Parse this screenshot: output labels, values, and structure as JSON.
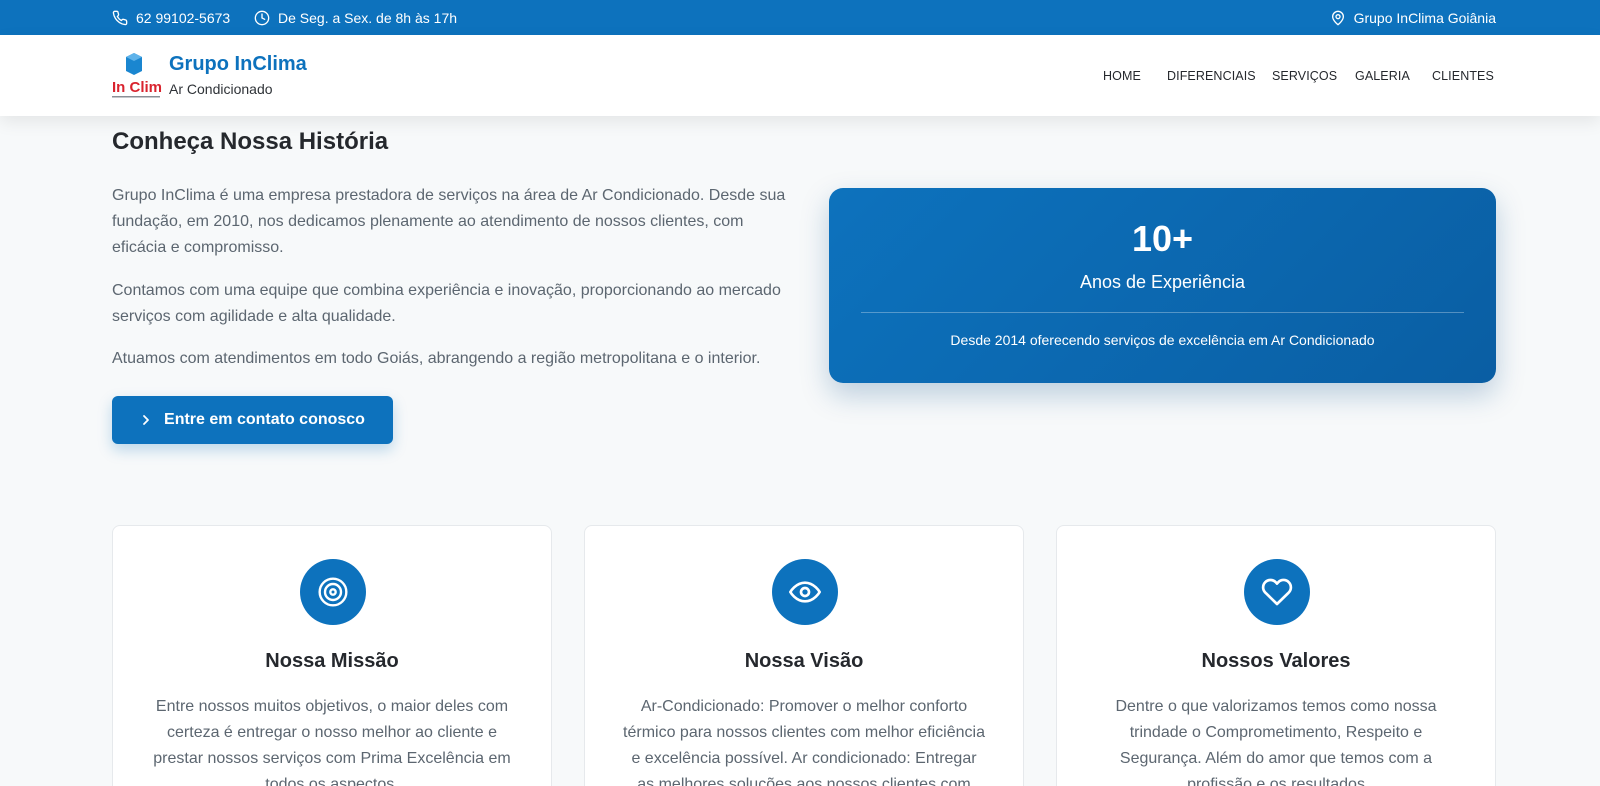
{
  "colors": {
    "primary": "#0d72bd",
    "background": "#f7f9fa",
    "text_muted": "#5c6670"
  },
  "topbar": {
    "phone": "62 99102-5673",
    "phone_icon": "phone-icon",
    "hours": "De Seg. a Sex. de 8h às 17h",
    "hours_icon": "clock-icon",
    "location": "Grupo InClima Goiânia",
    "location_icon": "map-pin-icon"
  },
  "header": {
    "brand_title": "Grupo InClima",
    "brand_subtitle": "Ar Condicionado",
    "logo_text": "In Clima",
    "nav": [
      "HOME",
      "DIFERENCIAIS",
      "SERVIÇOS",
      "GALERIA",
      "CLIENTES"
    ]
  },
  "history": {
    "title": "Conheça Nossa História",
    "paragraphs": [
      "Grupo InClima é uma empresa prestadora de serviços na área de Ar Condicionado. Desde sua fundação, em 2010, nos dedicamos plenamente ao atendimento de nossos clientes, com eficácia e compromisso.",
      "Contamos com uma equipe que combina experiência e inovação, proporcionando ao mercado serviços com agilidade e alta qualidade.",
      "Atuamos com atendimentos em todo Goiás, abrangendo a região metropolitana e o interior."
    ],
    "cta_label": "Entre em contato conosco",
    "cta_icon": "chevron-right-icon"
  },
  "experience": {
    "number": "10+",
    "label": "Anos de Experiência",
    "description": "Desde 2014 oferecendo serviços de excelência em Ar Condicionado"
  },
  "values": [
    {
      "icon": "target-icon",
      "title": "Nossa Missão",
      "text": "Entre nossos muitos objetivos, o maior deles com certeza é entregar o nosso melhor ao cliente e prestar nossos serviços com Prima Excelência em todos os aspectos."
    },
    {
      "icon": "eye-icon",
      "title": "Nossa Visão",
      "text": "Ar-Condicionado: Promover o melhor conforto térmico para nossos clientes com melhor eficiência e excelência possível. Ar condicionado: Entregar as melhores soluções aos nossos clientes com"
    },
    {
      "icon": "heart-icon",
      "title": "Nossos Valores",
      "text": "Dentre o que valorizamos temos como nossa trindade o Comprometimento, Respeito e Segurança. Além do amor que temos com a profissão e os resultados"
    }
  ]
}
